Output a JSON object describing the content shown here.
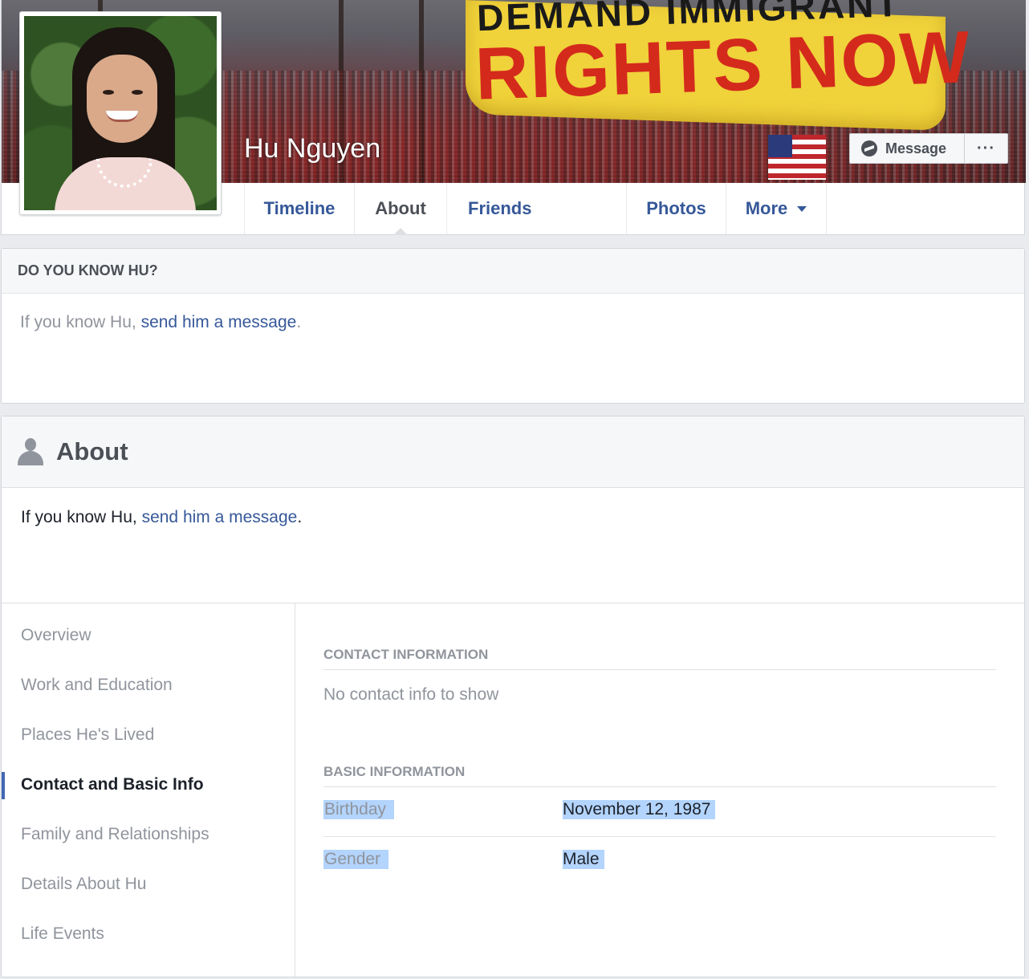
{
  "profile": {
    "name": "Hu Nguyen",
    "cover_banner_top": "DEMAND IMMIGRANT",
    "cover_banner_main": "RIGHTS NOW"
  },
  "actions": {
    "message_label": "Message",
    "more_label": "···"
  },
  "tabs": [
    {
      "label": "Timeline",
      "active": false
    },
    {
      "label": "About",
      "active": true
    },
    {
      "label": "Friends",
      "active": false
    },
    {
      "label": "Photos",
      "active": false
    },
    {
      "label": "More",
      "active": false
    }
  ],
  "know_card": {
    "title": "DO YOU KNOW HU?",
    "prefix": "If you know Hu, ",
    "link": "send him a message",
    "suffix": "."
  },
  "about": {
    "title": "About",
    "intro_prefix": "If you know Hu, ",
    "intro_link": "send him a message",
    "intro_suffix": ".",
    "nav": [
      {
        "label": "Overview"
      },
      {
        "label": "Work and Education"
      },
      {
        "label": "Places He's Lived"
      },
      {
        "label": "Contact and Basic Info",
        "active": true
      },
      {
        "label": "Family and Relationships"
      },
      {
        "label": "Details About Hu"
      },
      {
        "label": "Life Events"
      }
    ],
    "contact_heading": "CONTACT INFORMATION",
    "contact_empty": "No contact info to show",
    "basic_heading": "BASIC INFORMATION",
    "basic": [
      {
        "label": "Birthday",
        "value": "November 12, 1987"
      },
      {
        "label": "Gender",
        "value": "Male"
      }
    ]
  },
  "colors": {
    "link": "#365899",
    "muted": "#90949c",
    "selection": "#b3d4fc",
    "active_marker": "#4267b2"
  }
}
